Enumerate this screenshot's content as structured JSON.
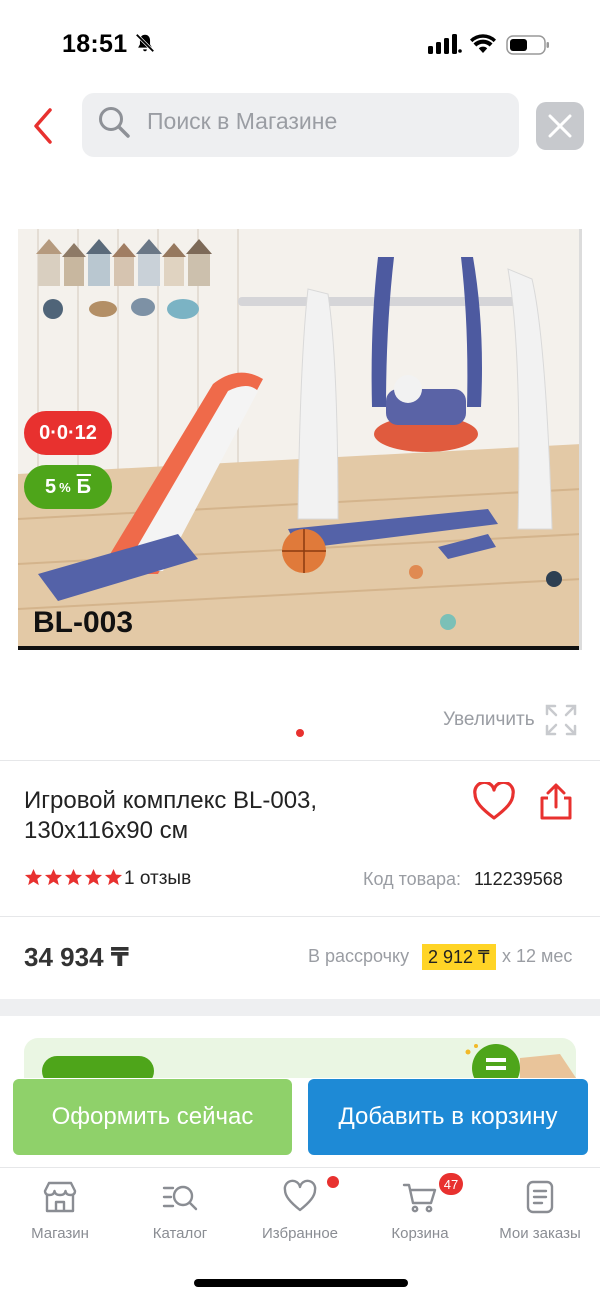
{
  "status_bar": {
    "time": "18:51"
  },
  "search": {
    "placeholder": "Поиск в Магазине"
  },
  "product": {
    "badge_timer": "0·0·12",
    "badge_bonus_value": "5",
    "badge_bonus_unit": "%",
    "badge_bonus_currency": "Б",
    "model_label": "BL-003",
    "zoom_label": "Увеличить",
    "image_count": 1,
    "active_image": 1,
    "title": "Игровой комплекс BL-003, 130x116x90 см",
    "rating": 5,
    "reviews": "1 отзыв",
    "sku_label": "Код товара:",
    "sku_value": "112239568",
    "price": "34 934 ₸",
    "installment_label": "В рассрочку",
    "installment_amount": "2 912 ₸",
    "installment_term": "x 12 мес"
  },
  "actions": {
    "buy_now": "Оформить сейчас",
    "add_to_cart": "Добавить в корзину"
  },
  "tabs": [
    {
      "label": "Магазин",
      "icon": "shop-icon"
    },
    {
      "label": "Каталог",
      "icon": "catalog-search-icon"
    },
    {
      "label": "Избранное",
      "icon": "heart-icon"
    },
    {
      "label": "Корзина",
      "icon": "cart-icon",
      "badge": "47"
    },
    {
      "label": "Мои заказы",
      "icon": "orders-icon"
    }
  ],
  "colors": {
    "accent_red": "#e8312f",
    "bonus_green": "#4ea51a",
    "buy_green": "#8fd16a",
    "cart_blue": "#1e8ad6",
    "installment_yellow": "#ffd426"
  }
}
